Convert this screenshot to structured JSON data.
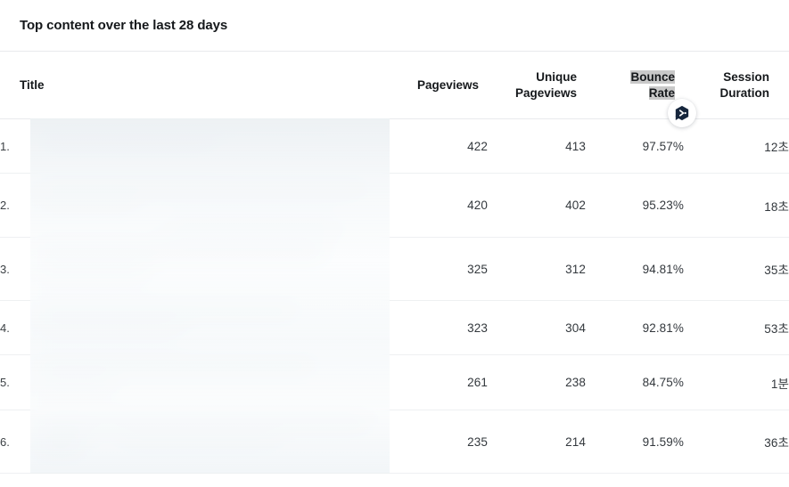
{
  "card": {
    "title": "Top content over the last 28 days"
  },
  "table": {
    "columns": [
      {
        "key": "title",
        "label": "Title",
        "align": "left"
      },
      {
        "key": "pv",
        "label": "Pageviews",
        "align": "right"
      },
      {
        "key": "upv",
        "label": "Unique\nPageviews",
        "align": "right",
        "line1": "Unique",
        "line2": "Pageviews"
      },
      {
        "key": "br",
        "label": "Bounce Rate",
        "align": "right",
        "line1": "Bounce",
        "line2": "Rate",
        "highlighted": true
      },
      {
        "key": "sd",
        "label": "Session Duration",
        "align": "right",
        "line1": "Session",
        "line2": "Duration"
      }
    ],
    "rows": [
      {
        "rank": "1.",
        "title": "",
        "pageviews": "422",
        "unique_pageviews": "413",
        "bounce_rate": "97.57%",
        "session_duration": "12초"
      },
      {
        "rank": "2.",
        "title": "",
        "pageviews": "420",
        "unique_pageviews": "402",
        "bounce_rate": "95.23%",
        "session_duration": "18초"
      },
      {
        "rank": "3.",
        "title": "",
        "pageviews": "325",
        "unique_pageviews": "312",
        "bounce_rate": "94.81%",
        "session_duration": "35초"
      },
      {
        "rank": "4.",
        "title": "",
        "pageviews": "323",
        "unique_pageviews": "304",
        "bounce_rate": "92.81%",
        "session_duration": "53초"
      },
      {
        "rank": "5.",
        "title": "",
        "pageviews": "261",
        "unique_pageviews": "238",
        "bounce_rate": "84.75%",
        "session_duration": "1분"
      },
      {
        "rank": "6.",
        "title": "",
        "pageviews": "235",
        "unique_pageviews": "214",
        "bounce_rate": "91.59%",
        "session_duration": "36초"
      }
    ]
  },
  "badge": {
    "icon": "hexagon-chevron-icon",
    "color": "#16263d"
  },
  "colors": {
    "text_primary": "#15181b",
    "text_body": "#3c4145",
    "divider": "#eef0f2",
    "header_divider": "#e8eaed",
    "selection_highlight": "#c9c9c9",
    "background": "#ffffff"
  }
}
